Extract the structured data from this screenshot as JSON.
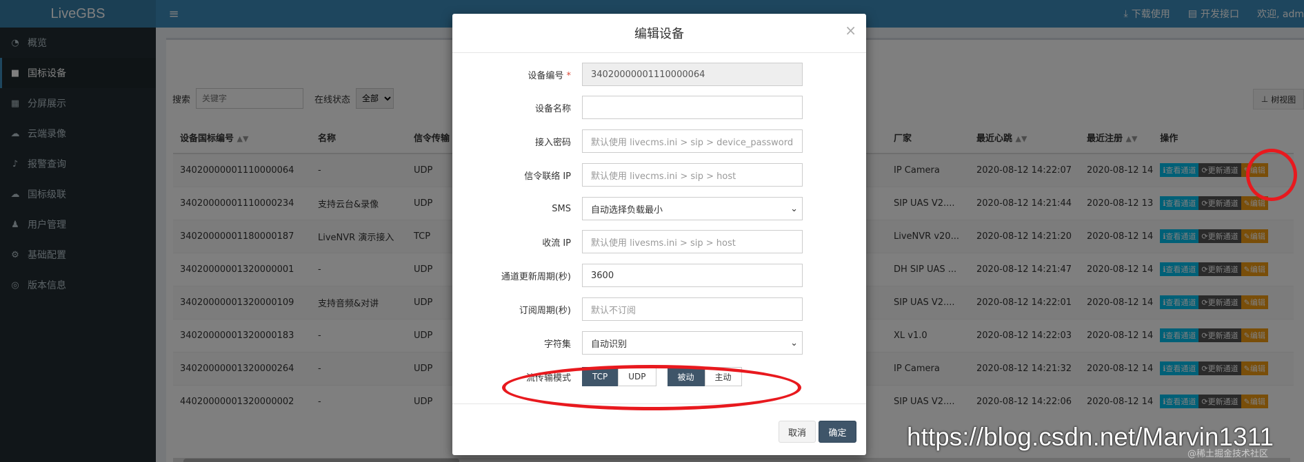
{
  "app": {
    "logo": "LiveGBS",
    "hamburger": "≡"
  },
  "topbar": {
    "links": [
      {
        "icon": "⤓",
        "label": "下载使用"
      },
      {
        "icon": "▤",
        "label": "开发接口"
      }
    ],
    "welcome": "欢迎, adm"
  },
  "sidebar": {
    "items": [
      {
        "icon": "◔",
        "label": "概览"
      },
      {
        "icon": "■",
        "label": "国标设备"
      },
      {
        "icon": "▦",
        "label": "分屏展示"
      },
      {
        "icon": "☁",
        "label": "云端录像"
      },
      {
        "icon": "♪",
        "label": "报警查询"
      },
      {
        "icon": "☁",
        "label": "国标级联"
      },
      {
        "icon": "♟",
        "label": "用户管理"
      },
      {
        "icon": "⚙",
        "label": "基础配置"
      },
      {
        "icon": "◎",
        "label": "版本信息"
      }
    ]
  },
  "filter": {
    "search_label": "搜索",
    "search_placeholder": "关键字",
    "status_label": "在线状态",
    "status_value": "全部",
    "tree_label": "树视图"
  },
  "table": {
    "headers": [
      "设备国标编号",
      "名称",
      "信令传输",
      "厂家",
      "最近心跳",
      "最近注册",
      "操作"
    ],
    "rows": [
      {
        "id": "34020000001110000064",
        "name": "-",
        "transport": "UDP",
        "vendor": "IP Camera",
        "heartbeat": "2020-08-12 14:22:07",
        "register": "2020-08-12 14"
      },
      {
        "id": "34020000001110000234",
        "name": "支持云台&录像",
        "transport": "UDP",
        "vendor": "SIP UAS V2....",
        "heartbeat": "2020-08-12 14:21:44",
        "register": "2020-08-12 13"
      },
      {
        "id": "34020000001180000187",
        "name": "LiveNVR 演示接入",
        "transport": "TCP",
        "vendor": "LiveNVR v20...",
        "heartbeat": "2020-08-12 14:21:20",
        "register": "2020-08-12 14"
      },
      {
        "id": "34020000001320000001",
        "name": "-",
        "transport": "UDP",
        "vendor": "DH SIP UAS ...",
        "heartbeat": "2020-08-12 14:21:47",
        "register": "2020-08-12 14"
      },
      {
        "id": "34020000001320000109",
        "name": "支持音频&对讲",
        "transport": "UDP",
        "vendor": "SIP UAS V2....",
        "heartbeat": "2020-08-12 14:22:01",
        "register": "2020-08-12 14"
      },
      {
        "id": "34020000001320000183",
        "name": "-",
        "transport": "UDP",
        "vendor": "XL v1.0",
        "heartbeat": "2020-08-12 14:22:03",
        "register": "2020-08-12 14"
      },
      {
        "id": "34020000001320000264",
        "name": "-",
        "transport": "UDP",
        "vendor": "IP Camera",
        "heartbeat": "2020-08-12 14:21:32",
        "register": "2020-08-12 14"
      },
      {
        "id": "44020000001320000002",
        "name": "-",
        "transport": "UDP",
        "vendor": "SIP UAS V2....",
        "heartbeat": "2020-08-12 14:22:06",
        "register": "2020-08-12 14"
      }
    ],
    "ops": {
      "view": "查看通道",
      "update": "更新通道",
      "edit": "编辑"
    }
  },
  "modal": {
    "title": "编辑设备",
    "close": "×",
    "fields": [
      {
        "label": "设备编号",
        "required": "*",
        "value": "34020000001110000064",
        "type": "readonly"
      },
      {
        "label": "设备名称",
        "value": "",
        "type": "input"
      },
      {
        "label": "接入密码",
        "placeholder": "默认使用 livecms.ini > sip > device_password",
        "type": "placeholder"
      },
      {
        "label": "信令联络 IP",
        "placeholder": "默认使用 livecms.ini > sip > host",
        "type": "placeholder"
      },
      {
        "label": "SMS",
        "value": "自动选择负载最小",
        "type": "select"
      },
      {
        "label": "收流 IP",
        "placeholder": "默认使用 livesms.ini > sip > host",
        "type": "placeholder"
      },
      {
        "label": "通道更新周期(秒)",
        "value": "3600",
        "type": "input"
      },
      {
        "label": "订阅周期(秒)",
        "placeholder": "默认不订阅",
        "type": "placeholder"
      },
      {
        "label": "字符集",
        "value": "自动识别",
        "type": "select"
      }
    ],
    "stream_mode": {
      "label": "流传输模式",
      "protocol": [
        "TCP",
        "UDP"
      ],
      "protocol_selected": "TCP",
      "mode": [
        "被动",
        "主动"
      ],
      "mode_selected": "被动"
    },
    "cancel": "取消",
    "ok": "确定"
  },
  "watermark": {
    "url": "https://blog.csdn.net/Marvin1311",
    "small": "@稀土掘金技术社区"
  }
}
